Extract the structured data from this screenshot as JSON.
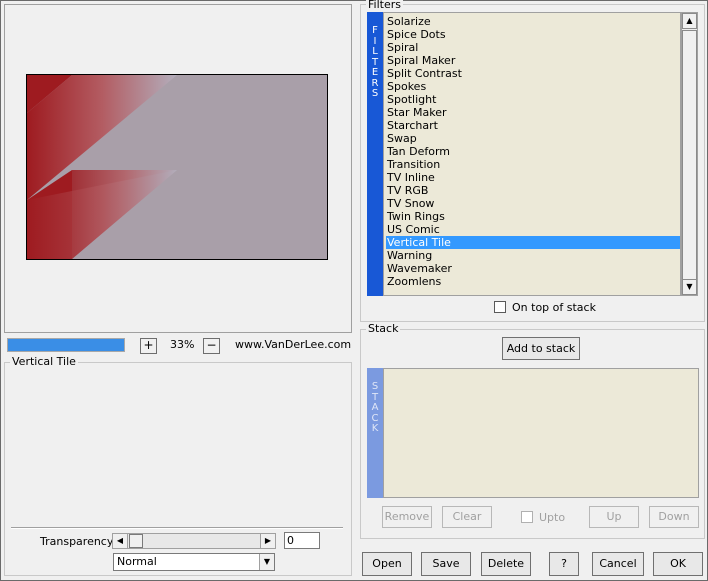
{
  "zoom": {
    "plus_label": "+",
    "minus_label": "−",
    "value": "33%",
    "website": "www.VanDerLee.com"
  },
  "progress": {
    "fraction": 1.0,
    "color": "#3a8ee6"
  },
  "params": {
    "title": "Vertical Tile",
    "transparency_label": "Transparency",
    "transparency_value": "0",
    "blend_mode": "Normal"
  },
  "filters": {
    "title": "Filters",
    "vertical_label": [
      "F",
      "I",
      "L",
      "T",
      "E",
      "R",
      "S"
    ],
    "items": [
      "Solarize",
      "Spice Dots",
      "Spiral",
      "Spiral Maker",
      "Split Contrast",
      "Spokes",
      "Spotlight",
      "Star Maker",
      "Starchart",
      "Swap",
      "Tan Deform",
      "Transition",
      "TV Inline",
      "TV RGB",
      "TV Snow",
      "Twin Rings",
      "US Comic",
      "Vertical Tile",
      "Warning",
      "Wavemaker",
      "Zoomlens"
    ],
    "selected": "Vertical Tile",
    "on_top_label": "On top of stack"
  },
  "stack": {
    "title": "Stack",
    "add_label": "Add to stack",
    "vertical_label": [
      "S",
      "T",
      "A",
      "C",
      "K"
    ],
    "remove_label": "Remove",
    "clear_label": "Clear",
    "upto_label": "Upto",
    "up_label": "Up",
    "down_label": "Down"
  },
  "bottom_buttons": {
    "open": "Open",
    "save": "Save",
    "delete": "Delete",
    "help": "?",
    "cancel": "Cancel",
    "ok": "OK"
  },
  "icons": {
    "scroll_left": "◀",
    "scroll_right": "▶",
    "scroll_up": "▲",
    "scroll_down": "▼",
    "dropdown": "▼"
  },
  "colors": {
    "accent": "#1858d6",
    "selection": "#3399ff",
    "list_bg": "#ece9d8",
    "preview_red": "#9e1b20",
    "preview_mauve": "#a79ea8"
  }
}
